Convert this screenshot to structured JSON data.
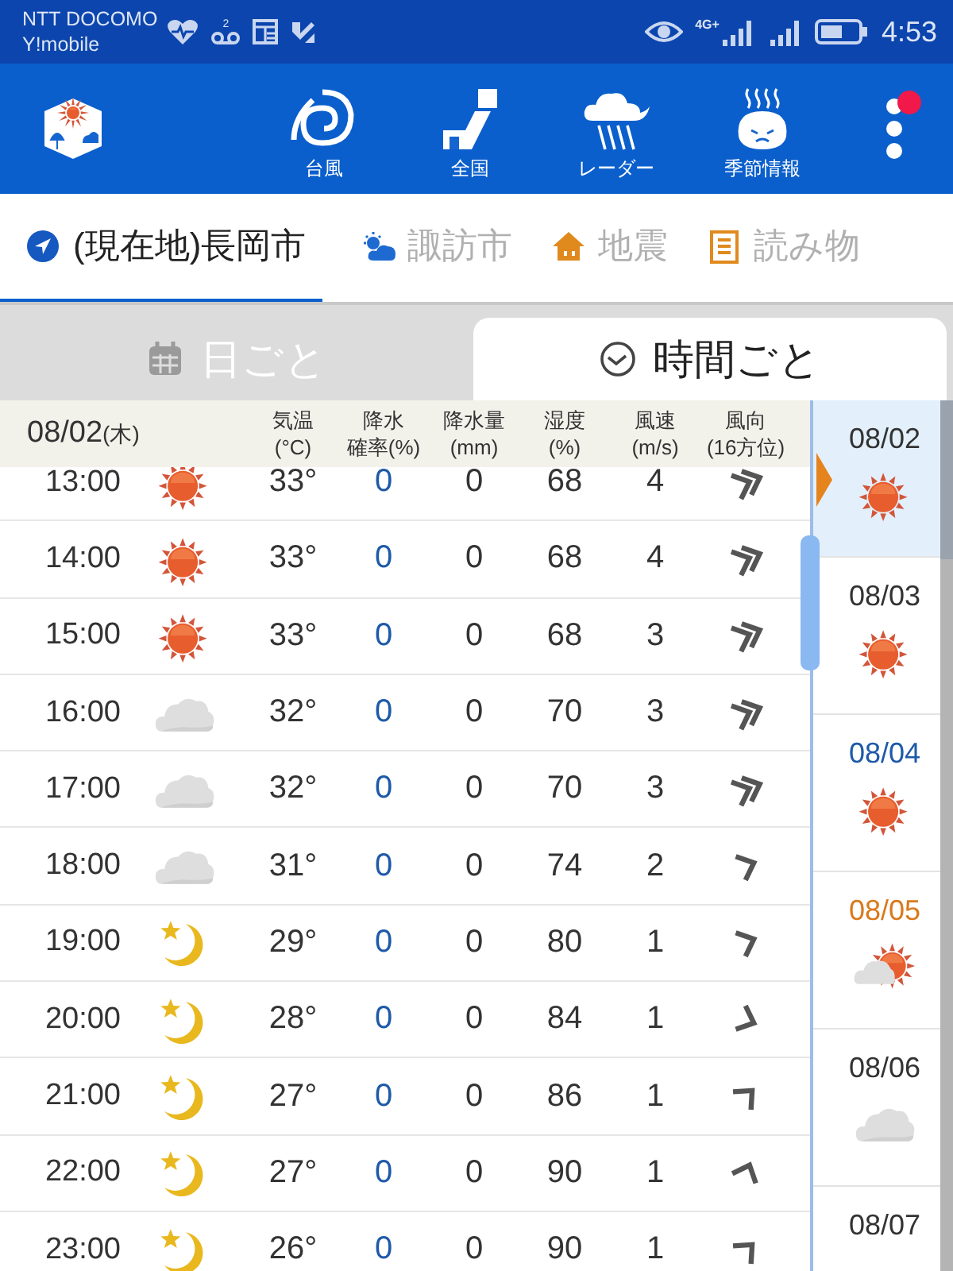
{
  "status_bar": {
    "carriers": [
      "NTT DOCOMO",
      "Y!mobile"
    ],
    "voicemail_count": "2",
    "network": "4G+",
    "time": "4:53"
  },
  "toolbar": {
    "items": [
      {
        "kind": "logo"
      },
      {
        "kind": "typhoon",
        "label": "台風"
      },
      {
        "kind": "nationwide",
        "label": "全国"
      },
      {
        "kind": "radar",
        "label": "レーダー"
      },
      {
        "kind": "season",
        "label": "季節情報"
      },
      {
        "kind": "menu",
        "notification": true
      }
    ]
  },
  "location_tabs": [
    {
      "kind": "location",
      "label": "(現在地)長岡市",
      "selected": true
    },
    {
      "kind": "weather",
      "label": "諏訪市",
      "selected": false
    },
    {
      "kind": "quake",
      "label": "地震",
      "selected": false
    },
    {
      "kind": "reading",
      "label": "読み物",
      "selected": false
    }
  ],
  "view_tabs": [
    {
      "kind": "daily",
      "label": "日ごと",
      "selected": false
    },
    {
      "kind": "hourly",
      "label": "時間ごと",
      "selected": true
    }
  ],
  "table": {
    "date": "08/02",
    "weekday": "(木)",
    "columns": [
      {
        "line1": "気温",
        "line2": "(°C)"
      },
      {
        "line1": "降水",
        "line2": "確率(%)"
      },
      {
        "line1": "降水量",
        "line2": "(mm)"
      },
      {
        "line1": "湿度",
        "line2": "(%)"
      },
      {
        "line1": "風速",
        "line2": "(m/s)"
      },
      {
        "line1": "風向",
        "line2": "(16方位)"
      }
    ],
    "rows": [
      {
        "time": "13:00",
        "weather": {
          "kind": "sunny"
        },
        "temp": "33°",
        "precip_prob": "0",
        "precip_mm": "0",
        "humidity": "68",
        "wind_speed": "4",
        "wind": {
          "kind": "double_ene"
        }
      },
      {
        "time": "14:00",
        "weather": {
          "kind": "sunny"
        },
        "temp": "33°",
        "precip_prob": "0",
        "precip_mm": "0",
        "humidity": "68",
        "wind_speed": "4",
        "wind": {
          "kind": "double_ene"
        }
      },
      {
        "time": "15:00",
        "weather": {
          "kind": "sunny"
        },
        "temp": "33°",
        "precip_prob": "0",
        "precip_mm": "0",
        "humidity": "68",
        "wind_speed": "3",
        "wind": {
          "kind": "double_ene"
        }
      },
      {
        "time": "16:00",
        "weather": {
          "kind": "cloudy"
        },
        "temp": "32°",
        "precip_prob": "0",
        "precip_mm": "0",
        "humidity": "70",
        "wind_speed": "3",
        "wind": {
          "kind": "double_ene"
        }
      },
      {
        "time": "17:00",
        "weather": {
          "kind": "cloudy"
        },
        "temp": "32°",
        "precip_prob": "0",
        "precip_mm": "0",
        "humidity": "70",
        "wind_speed": "3",
        "wind": {
          "kind": "double_ene"
        }
      },
      {
        "time": "18:00",
        "weather": {
          "kind": "cloudy"
        },
        "temp": "31°",
        "precip_prob": "0",
        "precip_mm": "0",
        "humidity": "74",
        "wind_speed": "2",
        "wind": {
          "kind": "single_ene"
        }
      },
      {
        "time": "19:00",
        "weather": {
          "kind": "night"
        },
        "temp": "29°",
        "precip_prob": "0",
        "precip_mm": "0",
        "humidity": "80",
        "wind_speed": "1",
        "wind": {
          "kind": "single_ene"
        }
      },
      {
        "time": "20:00",
        "weather": {
          "kind": "night"
        },
        "temp": "28°",
        "precip_prob": "0",
        "precip_mm": "0",
        "humidity": "84",
        "wind_speed": "1",
        "wind": {
          "kind": "single_ese"
        }
      },
      {
        "time": "21:00",
        "weather": {
          "kind": "night"
        },
        "temp": "27°",
        "precip_prob": "0",
        "precip_mm": "0",
        "humidity": "86",
        "wind_speed": "1",
        "wind": {
          "kind": "single_ne"
        }
      },
      {
        "time": "22:00",
        "weather": {
          "kind": "night"
        },
        "temp": "27°",
        "precip_prob": "0",
        "precip_mm": "0",
        "humidity": "90",
        "wind_speed": "1",
        "wind": {
          "kind": "single_nne"
        }
      },
      {
        "time": "23:00",
        "weather": {
          "kind": "night"
        },
        "temp": "26°",
        "precip_prob": "0",
        "precip_mm": "0",
        "humidity": "90",
        "wind_speed": "1",
        "wind": {
          "kind": "single_ne"
        }
      }
    ]
  },
  "days": [
    {
      "date": "08/02",
      "weather": {
        "kind": "sunny"
      },
      "color": "#333333",
      "selected": true
    },
    {
      "date": "08/03",
      "weather": {
        "kind": "sunny"
      },
      "color": "#333333",
      "selected": false
    },
    {
      "date": "08/04",
      "weather": {
        "kind": "sunny"
      },
      "color": "#1e5aa8",
      "selected": false
    },
    {
      "date": "08/05",
      "weather": {
        "kind": "cloud_sun"
      },
      "color": "#d9791e",
      "selected": false
    },
    {
      "date": "08/06",
      "weather": {
        "kind": "cloudy"
      },
      "color": "#333333",
      "selected": false
    },
    {
      "date": "08/07",
      "color": "#333333",
      "selected": false
    }
  ]
}
